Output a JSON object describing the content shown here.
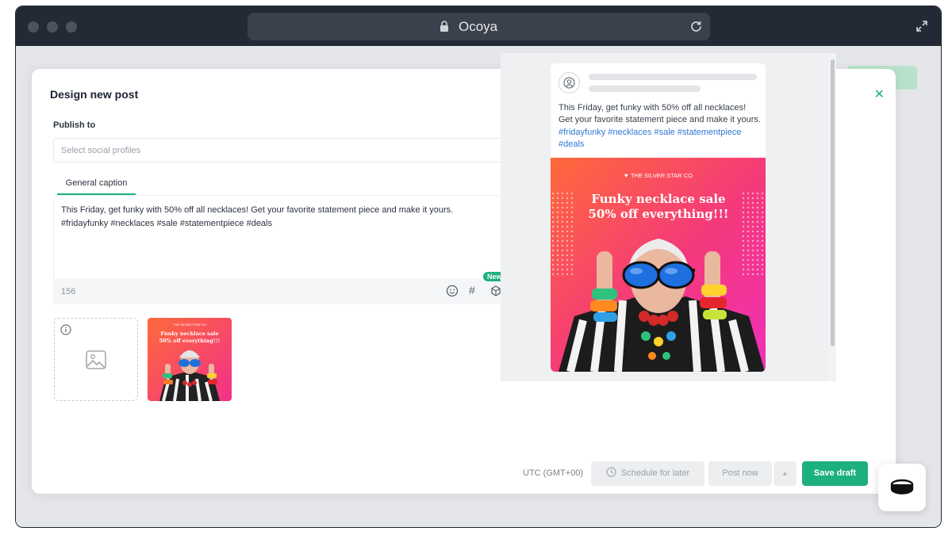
{
  "browser": {
    "title": "Ocoya"
  },
  "modal": {
    "title": "Design new post",
    "publish_to_label": "Publish to",
    "select_placeholder": "Select social profiles",
    "tab_label": "General caption",
    "caption_line1": "This Friday, get funky with 50% off all necklaces! Get your favorite statement piece and make it yours.",
    "caption_line2": "#fridayfunky #necklaces #sale #statementpiece #deals",
    "char_count": "156",
    "new_badge": "New",
    "timezone": "UTC (GMT+00)",
    "schedule_label": "Schedule for later",
    "post_now_label": "Post now",
    "save_draft_label": "Save draft"
  },
  "preview": {
    "text": "This Friday, get funky with 50% off all necklaces! Get your favorite statement piece and make it yours.",
    "hashtags": "#fridayfunky #necklaces #sale #statementpiece #deals",
    "brand": "THE SILVER STAR CO",
    "headline1": "Funky necklace sale",
    "headline2": "50% off everything!!!"
  },
  "thumbnail": {
    "brand": "THE SILVER STAR CO",
    "headline1": "Funky necklace sale",
    "headline2": "50% off everything!!!"
  },
  "colors": {
    "accent": "#1db07f",
    "hashtag": "#2e78d6",
    "poster_pink": "#f0308a",
    "poster_orange": "#ff6a3a"
  },
  "icons": [
    "lock-icon",
    "reload-icon",
    "expand-icon",
    "close-icon",
    "emoji-icon",
    "hashtag-icon",
    "ai-icon",
    "info-icon",
    "image-icon",
    "clock-icon",
    "chevron-up-icon"
  ]
}
